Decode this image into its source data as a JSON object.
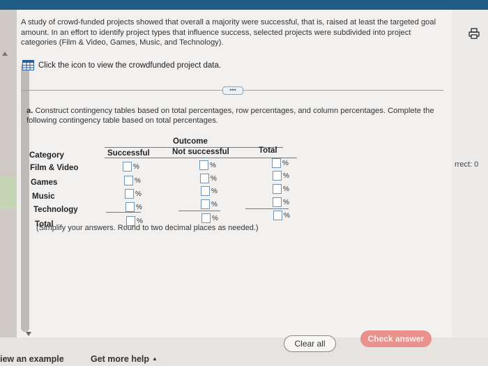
{
  "question": {
    "intro": "A study of crowd-funded projects showed that overall a majority were successful, that is, raised at least the targeted goal amount. In an effort to identify project types that influence success, selected projects were subdivided into project categories (Film & Video, Games, Music, and Technology).",
    "data_link": "Click the icon to view the crowdfunded project data.",
    "expander": "•••"
  },
  "part_a": {
    "label": "a.",
    "instruction": "Construct contingency tables based on total percentages, row percentages, and column percentages. Complete the following contingency table based on total percentages."
  },
  "table": {
    "outcome_header": "Outcome",
    "category_header": "Category",
    "col_successful": "Successful",
    "col_not_successful": "Not successful",
    "col_total": "Total",
    "rows": [
      {
        "label": "Film & Video"
      },
      {
        "label": "Games"
      },
      {
        "label": "Music"
      },
      {
        "label": "Technology"
      },
      {
        "label": "Total"
      }
    ],
    "percent_sign": "%",
    "hint": "(Simplify your answers. Round to two decimal places as needed.)"
  },
  "side_panel": {
    "label": "rrect: 0",
    "print_icon": "print-icon"
  },
  "footer": {
    "example": "iew an example",
    "help": "Get more help",
    "help_caret": "▲",
    "clear": "Clear all",
    "check": "Check answer"
  },
  "colors": {
    "topbar": "#1f5f86",
    "check_button": "#e9928c",
    "input_border": "#6f93b3"
  }
}
